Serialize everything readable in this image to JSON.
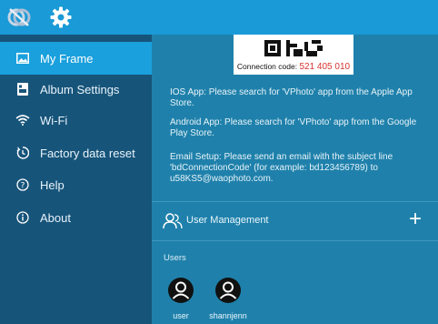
{
  "sidebar": {
    "items": [
      {
        "label": "My Frame",
        "icon": "image-icon",
        "active": true
      },
      {
        "label": "Album Settings",
        "icon": "album-icon",
        "active": false
      },
      {
        "label": "Wi-Fi",
        "icon": "wifi-icon",
        "active": false
      },
      {
        "label": "Factory data reset",
        "icon": "reset-icon",
        "active": false
      },
      {
        "label": "Help",
        "icon": "help-icon",
        "active": false
      },
      {
        "label": "About",
        "icon": "info-icon",
        "active": false
      }
    ]
  },
  "connection": {
    "label": "Connection code:",
    "code": "521 405 010"
  },
  "instructions": {
    "ios": "IOS App: Please search for 'VPhoto' app from the Apple App Store.",
    "android": "Android App: Please search for 'VPhoto' app from the Google Play Store.",
    "email": "Email Setup: Please send an email with the subject line 'bdConnectionCode' (for example: bd123456789) to u58KS5@waophoto.com."
  },
  "user_management": {
    "title": "User Management",
    "add_label": "+",
    "users_heading": "Users",
    "users": [
      {
        "name": "user"
      },
      {
        "name": "shannjenn"
      }
    ]
  },
  "colors": {
    "topbar": "#1a9ad6",
    "sidebar": "#17547a",
    "active": "#1aa0dd",
    "main": "#1f81ab",
    "code": "#d6332f"
  }
}
